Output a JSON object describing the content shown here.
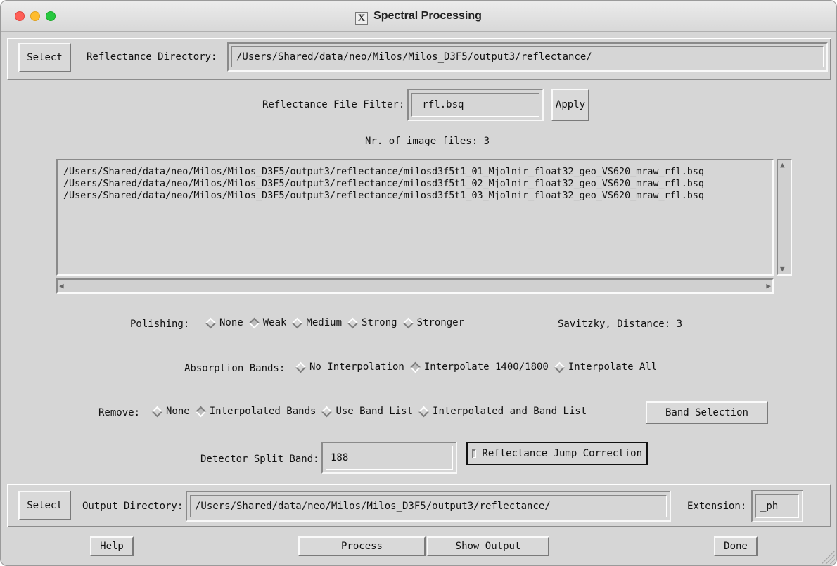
{
  "window": {
    "title": "Spectral Processing",
    "app_icon": "X"
  },
  "reflectance": {
    "select_label": "Select",
    "directory_label": "Reflectance Directory:",
    "directory_value": "/Users/Shared/data/neo/Milos/Milos_D3F5/output3/reflectance/",
    "filter_label": "Reflectance File Filter:",
    "filter_value": "_rfl.bsq",
    "apply_label": "Apply",
    "count_text": "Nr. of image files: 3",
    "files": [
      "/Users/Shared/data/neo/Milos/Milos_D3F5/output3/reflectance/milosd3f5t1_01_Mjolnir_float32_geo_VS620_mraw_rfl.bsq",
      "/Users/Shared/data/neo/Milos/Milos_D3F5/output3/reflectance/milosd3f5t1_02_Mjolnir_float32_geo_VS620_mraw_rfl.bsq",
      "/Users/Shared/data/neo/Milos/Milos_D3F5/output3/reflectance/milosd3f5t1_03_Mjolnir_float32_geo_VS620_mraw_rfl.bsq"
    ]
  },
  "polishing": {
    "label": "Polishing:",
    "options": [
      "None",
      "Weak",
      "Medium",
      "Strong",
      "Stronger"
    ],
    "selected": "Weak",
    "savitzky_text": "Savitzky, Distance: 3"
  },
  "absorption": {
    "label": "Absorption Bands:",
    "options": [
      "No Interpolation",
      "Interpolate 1400/1800",
      "Interpolate All"
    ],
    "selected": "Interpolate 1400/1800"
  },
  "remove": {
    "label": "Remove:",
    "options": [
      "None",
      "Interpolated Bands",
      "Use Band List",
      "Interpolated and Band List"
    ],
    "selected": "Interpolated Bands",
    "band_selection_label": "Band Selection"
  },
  "detector": {
    "label": "Detector Split Band:",
    "value": "188",
    "jump_correction_label": "Reflectance Jump Correction",
    "jump_correction_checked": false
  },
  "output": {
    "select_label": "Select",
    "directory_label": "Output Directory:",
    "directory_value": "/Users/Shared/data/neo/Milos/Milos_D3F5/output3/reflectance/",
    "extension_label": "Extension:",
    "extension_value": "_ph"
  },
  "footer": {
    "help_label": "Help",
    "process_label": "Process",
    "show_output_label": "Show Output",
    "done_label": "Done"
  }
}
